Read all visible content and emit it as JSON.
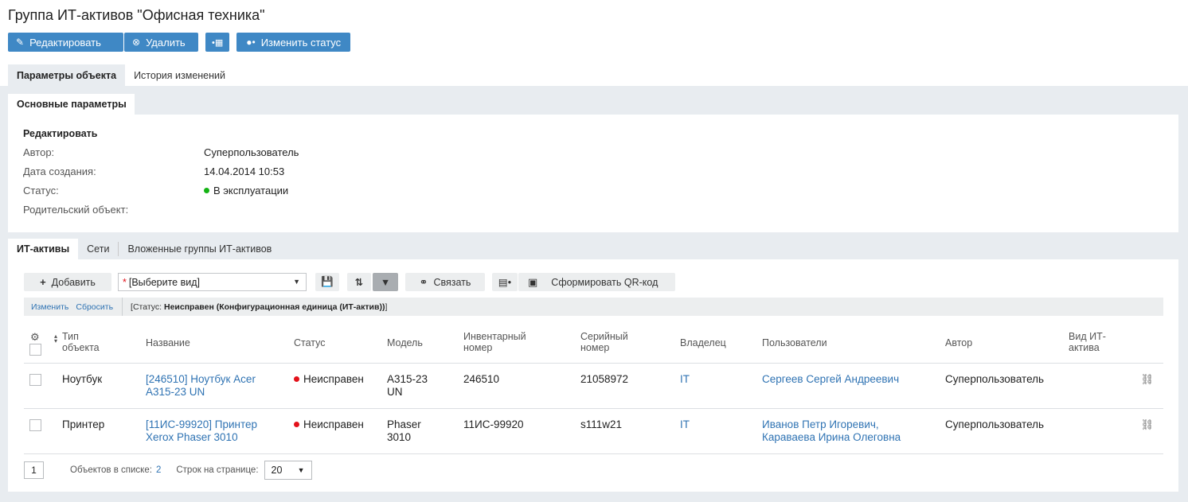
{
  "page_title": "Группа ИТ-активов \"Офисная техника\"",
  "toolbar": {
    "edit_label": "Редактировать",
    "delete_label": "Удалить",
    "change_status_label": "Изменить статус",
    "accent_color": "#3f88c5"
  },
  "main_tabs": [
    {
      "label": "Параметры объекта",
      "active": true
    },
    {
      "label": "История изменений",
      "active": false
    }
  ],
  "params_panel": {
    "tab_label": "Основные параметры",
    "section_title": "Редактировать",
    "fields": [
      {
        "label": "Автор:",
        "value": "Суперпользователь"
      },
      {
        "label": "Дата создания:",
        "value": "14.04.2014 10:53"
      },
      {
        "label": "Статус:",
        "value": "В эксплуатации",
        "status_color": "#14b314"
      },
      {
        "label": "Родительский объект:",
        "value": ""
      }
    ]
  },
  "sub_tabs": [
    {
      "label": "ИТ-активы",
      "active": true
    },
    {
      "label": "Сети",
      "active": false
    },
    {
      "label": "Вложенные группы ИТ-активов",
      "active": false
    }
  ],
  "list_toolbar": {
    "add_label": "Добавить",
    "select_placeholder": "[Выберите вид]",
    "link_label": "Связать",
    "qr_label": "Сформировать QR-код"
  },
  "filter": {
    "change_label": "Изменить",
    "reset_label": "Сбросить",
    "prefix": "[Статус: ",
    "value": "Неисправен (Конфигурационная единица (ИТ-актив))",
    "suffix": "]"
  },
  "table": {
    "columns": {
      "type": "Тип объекта",
      "name": "Название",
      "status": "Статус",
      "model": "Модель",
      "inventory": "Инвентарный номер",
      "serial": "Серийный номер",
      "owner": "Владелец",
      "users": "Пользователи",
      "author": "Автор",
      "kind": "Вид ИТ-актива"
    },
    "rows": [
      {
        "type": "Ноутбук",
        "name": "[246510] Ноутбук Acer A315-23 UN",
        "status": "Неисправен",
        "model": "A315-23 UN",
        "inventory": "246510",
        "serial": "21058972",
        "owner": "IT",
        "users": "Сергеев Сергей Андреевич",
        "author": "Суперпользователь",
        "kind": ""
      },
      {
        "type": "Принтер",
        "name": "[11ИС-99920] Принтер Xerox Phaser 3010",
        "status": "Неисправен",
        "model": "Phaser 3010",
        "inventory": "11ИС-99920",
        "serial": "s111w21",
        "owner": "IT",
        "users": "Иванов Петр Игоревич, Караваева Ирина Олеговна",
        "author": "Суперпользователь",
        "kind": ""
      }
    ]
  },
  "pager": {
    "page": "1",
    "count_label": "Объектов в списке:",
    "count": "2",
    "rows_label": "Строк на странице:",
    "rows_per_page": "20"
  }
}
